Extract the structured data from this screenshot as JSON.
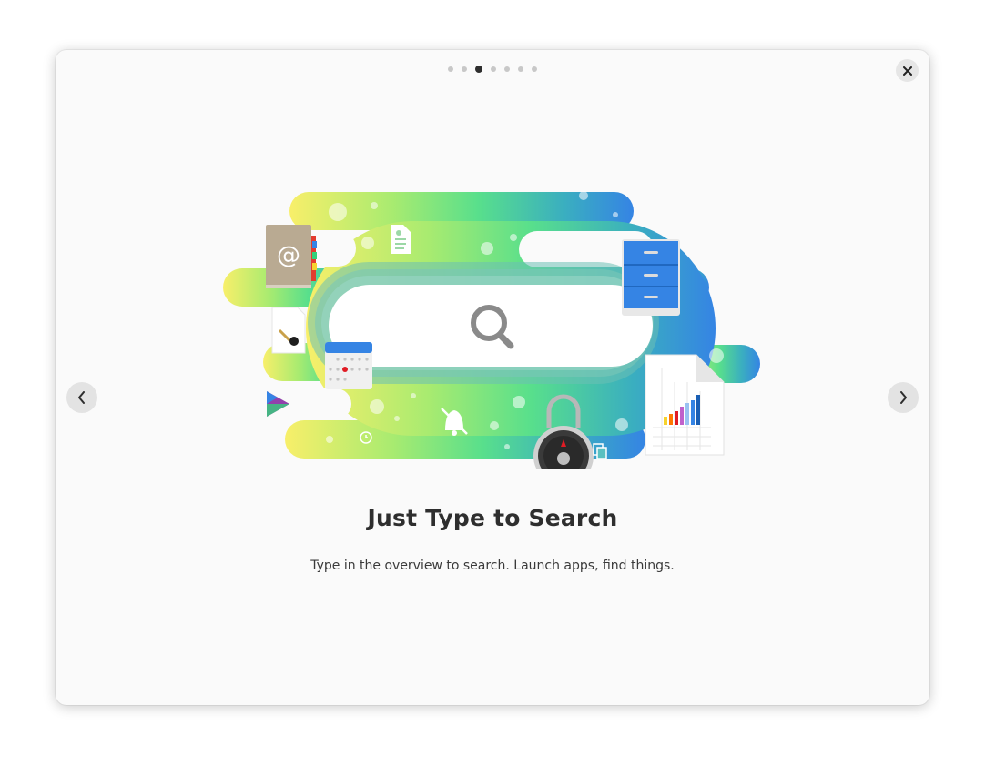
{
  "pager": {
    "page_count": 7,
    "current_page": 3
  },
  "slide": {
    "title": "Just Type to Search",
    "description": "Type in the overview to search. Launch apps, find things."
  },
  "icons": {
    "close": "close-icon",
    "prev": "chevron-left-icon",
    "next": "chevron-right-icon",
    "search": "search-icon"
  },
  "colors": {
    "gradient_start": "#f8ef6a",
    "gradient_mid": "#58df8c",
    "gradient_end": "#3584e4",
    "file_cabinet": "#3584e4"
  }
}
